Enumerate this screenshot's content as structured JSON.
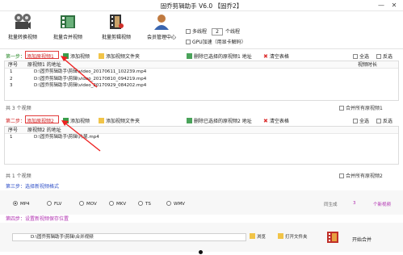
{
  "window": {
    "title": "固乔剪辑助手 V6.0 【固乔2】",
    "minimize": "—",
    "close": "✕"
  },
  "toolbar": {
    "batch_convert": "批量转换视频",
    "batch_merge": "批量合并视频",
    "batch_cut": "批量剪辑视频",
    "member_center": "会员管理中心"
  },
  "options": {
    "multithread_label": "多线程",
    "thread_count": "2",
    "thread_suffix": "个线程",
    "gpu_label": "GPU加速（用显卡解码）"
  },
  "step1": {
    "step_label": "第一步：",
    "add_video": "添加原视频1",
    "add_video_btn": "添加视频",
    "add_folder": "添加视频文件夹",
    "delete_selected": "删除已选择的原视频1 地址",
    "clear_table": "清空表格",
    "select_all": "全选",
    "invert": "反选",
    "col_seq": "序号",
    "col_path": "原视频1 的地址",
    "col_duration": "视频时长",
    "rows": [
      {
        "seq": "1",
        "path": "D:\\固乔剪辑助手\\剪辑\\video_20170611_102239.mp4"
      },
      {
        "seq": "2",
        "path": "D:\\固乔剪辑助手\\剪辑\\video_20170810_094219.mp4"
      },
      {
        "seq": "3",
        "path": "D:\\固乔剪辑助手\\剪辑\\video_20170929_084202.mp4"
      }
    ],
    "count": "共 3 个视频",
    "merge_all": "合并所有原视频1"
  },
  "step2": {
    "step_label": "第二步：",
    "add_video": "添加原视频2",
    "add_video_btn": "添加视频",
    "add_folder": "添加视频文件夹",
    "delete_selected": "删除已选择的原视频2 地址",
    "clear_table": "清空表格",
    "select_all": "全选",
    "invert": "反选",
    "col_seq": "序号",
    "col_path": "原视频2 的地址",
    "rows": [
      {
        "seq": "1",
        "path": "D:\\固乔剪辑助手\\剪辑\\片尾.mp4"
      }
    ],
    "count": "共 1 个视频",
    "merge_all": "合并所有原视频2"
  },
  "step3": {
    "step_label": "第三步：选择新视频格式",
    "formats": [
      "MP4",
      "FLV",
      "MOV",
      "MKV",
      "TS",
      "WMV"
    ],
    "selected": "MP4",
    "generate_label": "同生成",
    "generate_count": "3",
    "generate_suffix": "个新视频"
  },
  "step4": {
    "step_label": "第四步：设置新视频保存位置",
    "save_path": "D:\\固乔剪辑助手\\剪辑\\合并视频",
    "browse": "浏览",
    "open_folder": "打开文件夹",
    "start": "开始合并"
  },
  "colors": {
    "red": "#d02020",
    "green": "#2a8a2a",
    "blue": "#3050c8",
    "accent_purple": "#b030b0"
  }
}
